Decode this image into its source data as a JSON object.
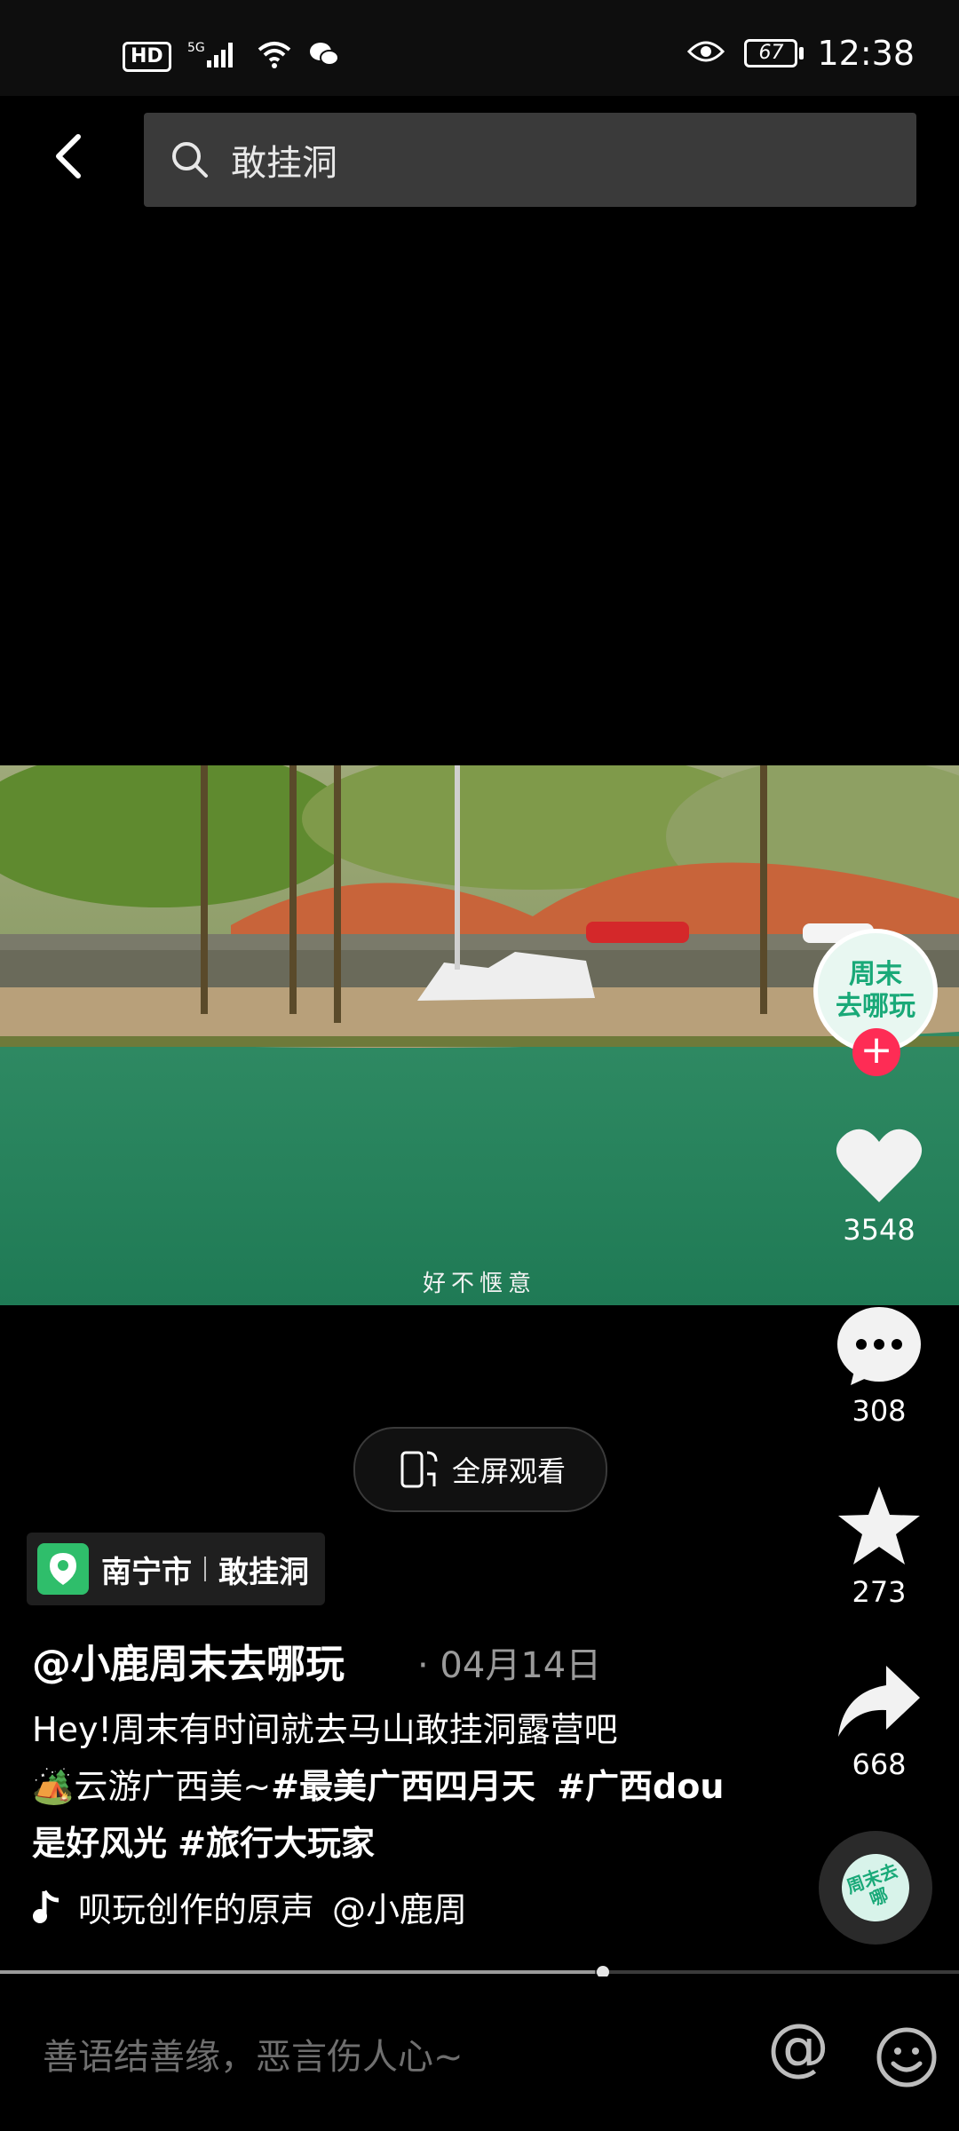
{
  "status_bar": {
    "hd": "HD",
    "network": "5G",
    "battery": "67",
    "time": "12:38"
  },
  "search": {
    "query": "敢挂洞"
  },
  "video": {
    "subtitle": "好不惬意"
  },
  "creator": {
    "avatar_text_line1": "周末",
    "avatar_text_line2": "去哪玩",
    "follow": "+"
  },
  "actions": {
    "likes": "3548",
    "comments": "308",
    "favorites": "273",
    "shares": "668"
  },
  "fullscreen": {
    "label": "全屏观看"
  },
  "location": {
    "city": "南宁市",
    "place": "敢挂洞"
  },
  "post": {
    "author": "@小鹿周末去哪玩",
    "date": "· 04月14日",
    "desc_line1": "Hey!周末有时间就去马山敢挂洞露营吧",
    "desc_emoji": "🏕️",
    "desc_line2_text": "云游广西美~",
    "tag1": "#最美广西四月天",
    "tag2": "#广西dou是好风光",
    "tag3": "#旅行大玩家"
  },
  "music": {
    "label": "呗玩创作的原声",
    "author": "@小鹿周"
  },
  "disc": {
    "text": "周末去哪"
  },
  "progress": {
    "fraction": 0.62
  },
  "comment": {
    "placeholder": "善语结善缘，恶言伤人心~",
    "at": "@"
  },
  "colors": {
    "accent": "#fe2c55",
    "brand": "#19a978"
  }
}
